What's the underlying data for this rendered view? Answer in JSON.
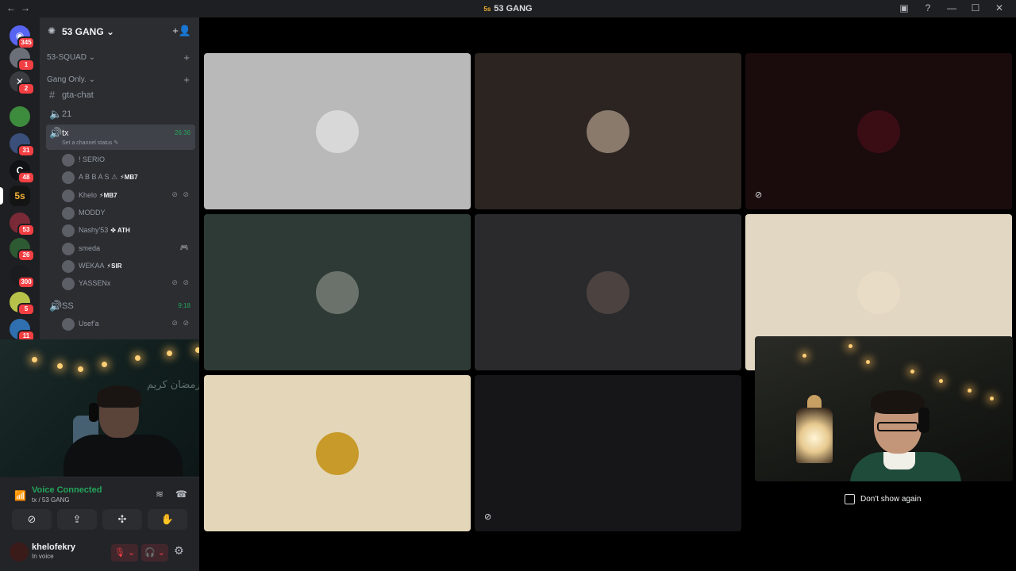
{
  "window": {
    "title": "53 GANG",
    "title_icon": "5s",
    "nav_back": "←",
    "nav_forward": "→",
    "controls": {
      "inbox": "▣",
      "help": "?",
      "minimize": "—",
      "maximize": "☐",
      "close": "✕"
    }
  },
  "servers": [
    {
      "name": "direct-messages",
      "badge": "345",
      "color": "#5865f2",
      "glyph": "◉"
    },
    {
      "name": "server-1",
      "badge": "1",
      "color": "#6b6f78",
      "glyph": ""
    },
    {
      "name": "server-2",
      "badge": "2",
      "color": "#3a3c42",
      "glyph": "✕"
    },
    {
      "name": "server-3",
      "badge": "",
      "color": "#3d8b3d",
      "glyph": ""
    },
    {
      "name": "server-4",
      "badge": "31",
      "color": "#3a4f7a",
      "glyph": ""
    },
    {
      "name": "server-5",
      "badge": "48",
      "color": "#101216",
      "glyph": "C"
    },
    {
      "name": "53-gang",
      "badge": "",
      "color": "#141414",
      "glyph": "5s",
      "active": true
    },
    {
      "name": "server-7",
      "badge": "53",
      "color": "#7a2a36",
      "glyph": ""
    },
    {
      "name": "server-8",
      "badge": "26",
      "color": "#2d5a32",
      "glyph": ""
    },
    {
      "name": "server-9",
      "badge": "300",
      "color": "#1b1c1f",
      "glyph": ""
    },
    {
      "name": "server-10",
      "badge": "5",
      "color": "#b7c24a",
      "glyph": ""
    },
    {
      "name": "server-11",
      "badge": "11",
      "color": "#2f6fb0",
      "glyph": ""
    }
  ],
  "guild": {
    "name": "53 GANG",
    "caret": "⌄",
    "invite_icon": "+👤"
  },
  "categories": [
    {
      "label": "53-SQUAD ⌄"
    },
    {
      "label": "Gang Only. ⌄"
    }
  ],
  "channels": {
    "gta_chat": {
      "label": "gta-chat",
      "icon": "#"
    },
    "voice_21": {
      "label": "21",
      "icon": "🔈"
    },
    "tx": {
      "label": "tx",
      "time": "26:36",
      "status": "Set a channel status ✎",
      "icon": "🔊"
    },
    "ss": {
      "label": "SS",
      "time": "9:18",
      "icon": "🔊"
    }
  },
  "tx_users": [
    {
      "name": "! SERIO",
      "tag": "",
      "icons": "",
      "activity": ""
    },
    {
      "name": "A B B A S ⚠",
      "tag": "⚡MB7",
      "icons": "",
      "activity": ""
    },
    {
      "name": "Khelo",
      "tag": "⚡MB7",
      "icons": "⊘ ⊘",
      "activity": ""
    },
    {
      "name": "MODDY",
      "tag": "",
      "icons": "",
      "activity": ""
    },
    {
      "name": "Nashy'53",
      "tag": "✤ ATH",
      "icons": "",
      "activity": ""
    },
    {
      "name": "smeda",
      "tag": "",
      "icons": "",
      "activity": "🎮"
    },
    {
      "name": "WEKAA",
      "tag": "⚡SIR",
      "icons": "",
      "activity": ""
    },
    {
      "name": "YASSENx",
      "tag": "",
      "icons": "⊘ ⊘",
      "activity": ""
    }
  ],
  "ss_users": [
    {
      "name": "Usef’a",
      "tag": "",
      "icons": "⊘ ⊘",
      "activity": ""
    }
  ],
  "webcam_left": {
    "sign_text": "رمضان كريم"
  },
  "voice_panel": {
    "title": "Voice Connected",
    "subtitle": "tx / 53 GANG",
    "signal_icon": "📶",
    "noise_icon": "≋",
    "disconnect_icon": "☎",
    "buttons": [
      "⊘",
      "⇪",
      "✣",
      "✋"
    ]
  },
  "user_panel": {
    "username": "khelofekry",
    "status": "In voice",
    "mic_icon": "🎙 ⌄",
    "headset_icon": "🎧 ⌄",
    "gear_icon": "⚙"
  },
  "tiles": [
    {
      "bg": "#b9b9b9",
      "av_color": "#d8d8d8",
      "muted": false
    },
    {
      "bg": "#2b2421",
      "av_color": "#8a7a6c",
      "muted": false
    },
    {
      "bg": "#1a0b0d",
      "av_color": "#3a0d14",
      "muted": true
    },
    {
      "bg": "#2e3a36",
      "av_color": "#6b726b",
      "muted": false
    },
    {
      "bg": "#2a2a2c",
      "av_color": "#4c4340",
      "muted": false
    },
    {
      "bg": "#e1d7c3",
      "av_color": "#e8dcc6",
      "muted": false
    },
    {
      "bg": "#e4d6b8",
      "av_color": "#c79a2a",
      "muted": false
    },
    {
      "bg": "#161618",
      "av_color": "#161618",
      "muted": true
    }
  ],
  "tile_mute_icon": "⊘",
  "dont_show": {
    "label": "Don't show again"
  }
}
